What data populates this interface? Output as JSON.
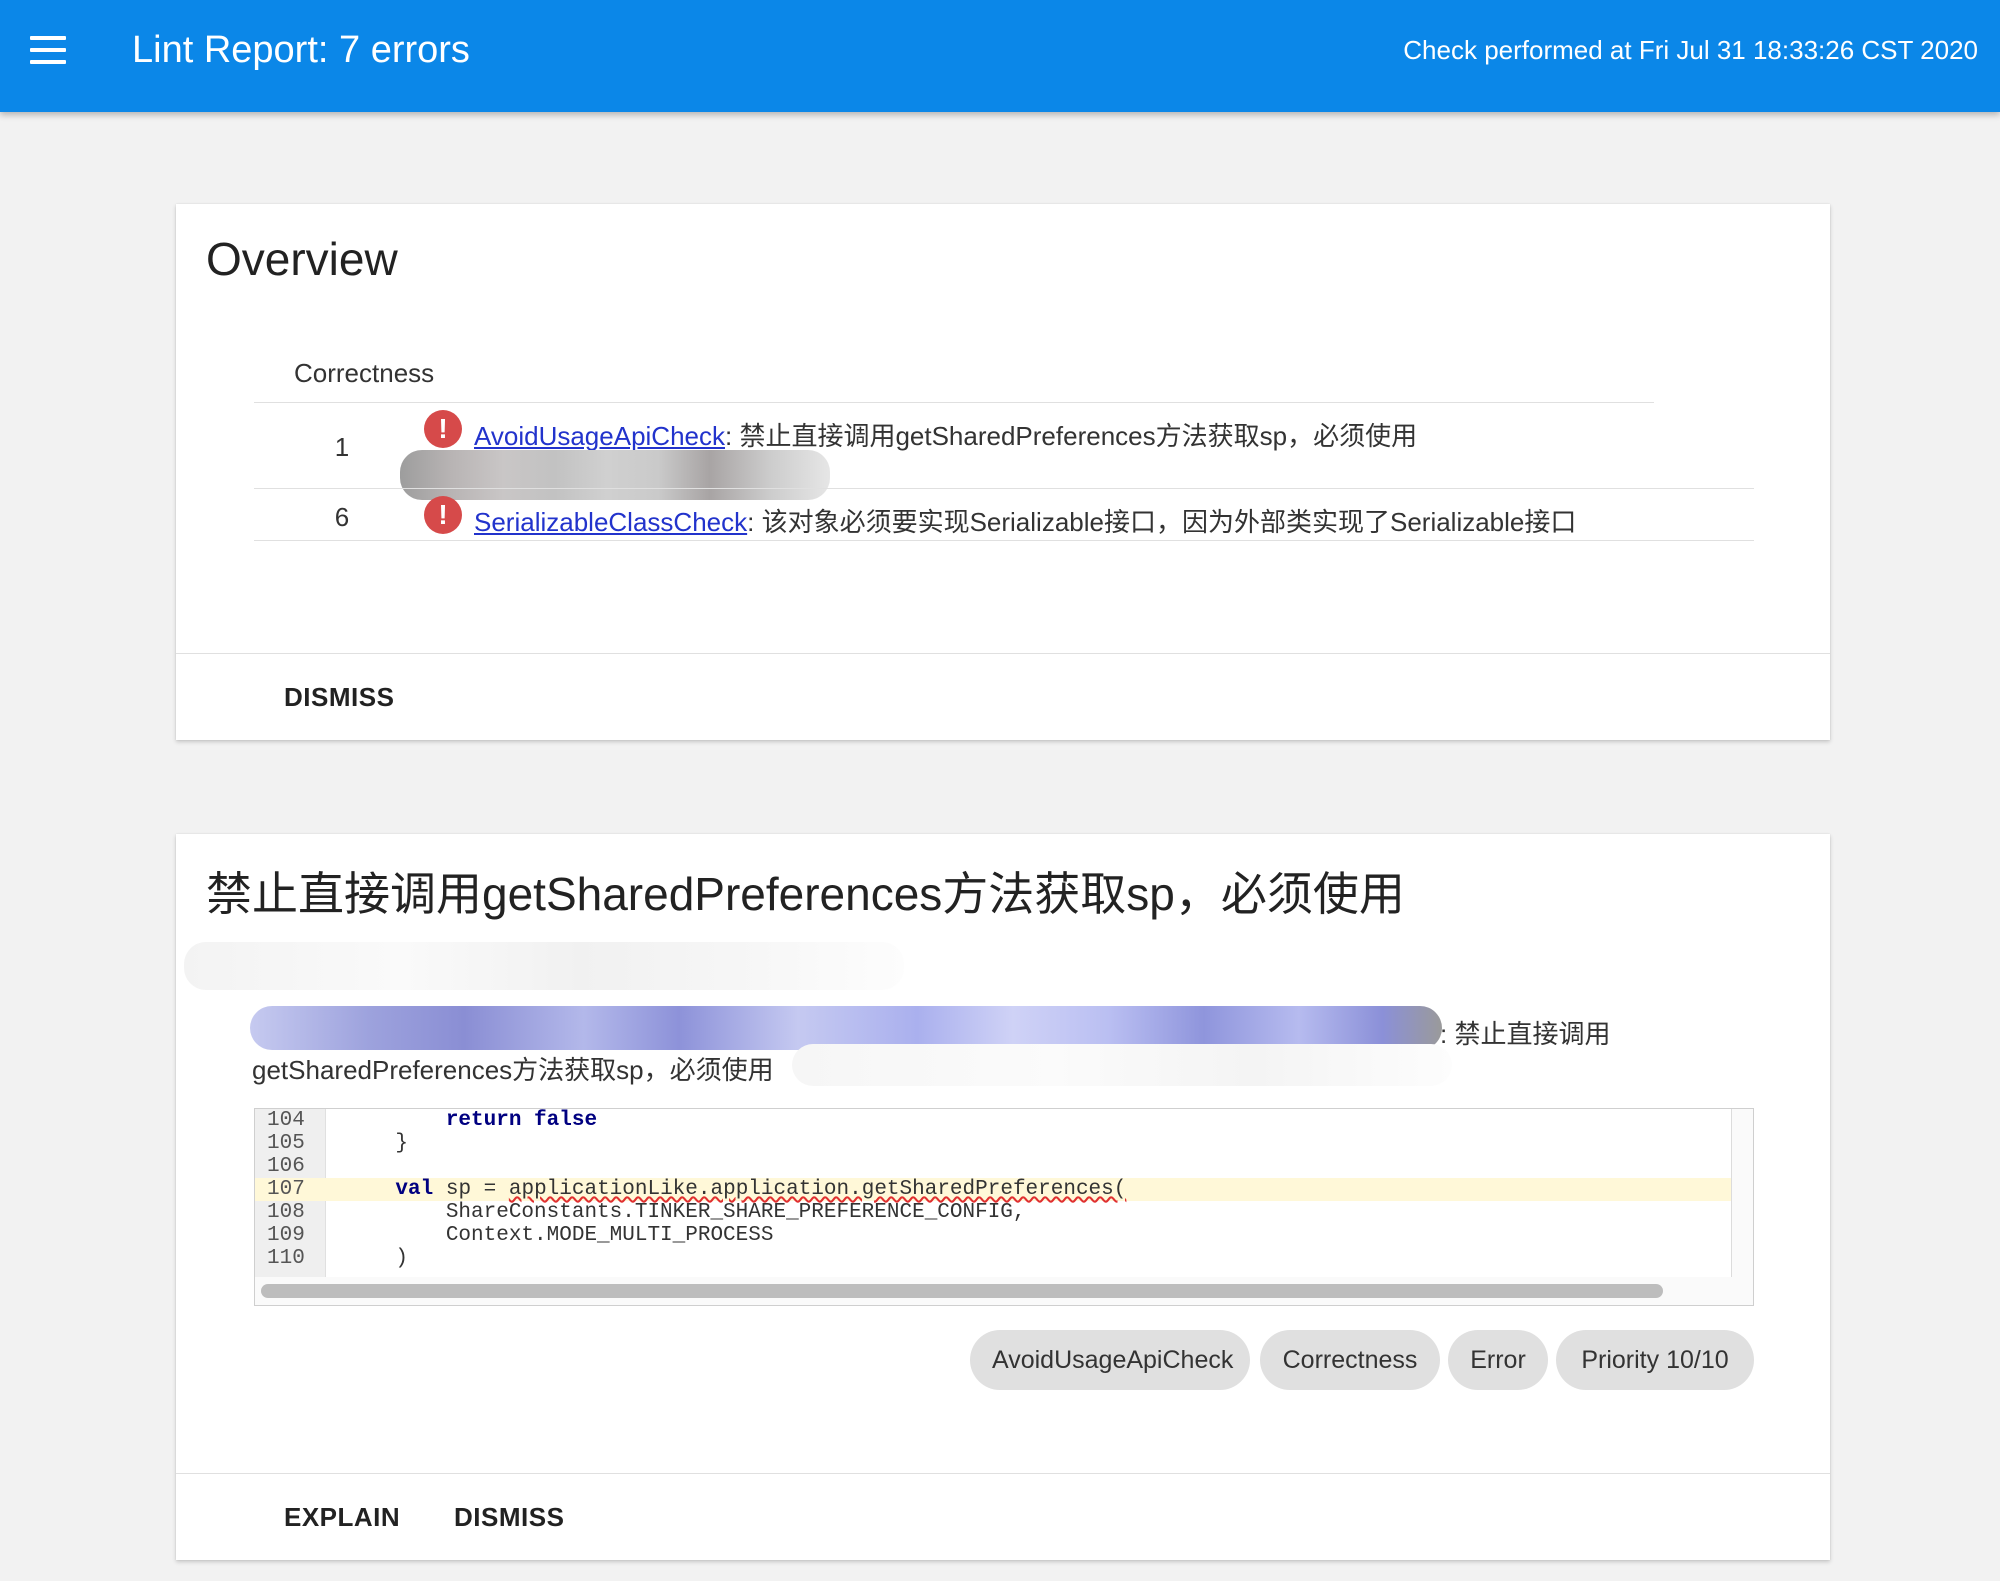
{
  "header": {
    "title": "Lint Report: 7 errors",
    "check_time": "Check performed at Fri Jul 31 18:33:26 CST 2020"
  },
  "overview": {
    "title": "Overview",
    "category": "Correctness",
    "rows": [
      {
        "count": "1",
        "issue_id": "AvoidUsageApiCheck",
        "message": ": 禁止直接调用getSharedPreferences方法获取sp，必须使用"
      },
      {
        "count": "6",
        "issue_id": "SerializableClassCheck",
        "message": ": 该对象必须要实现Serializable接口，因为外部类实现了Serializable接口"
      }
    ],
    "dismiss_label": "DISMISS"
  },
  "issue": {
    "title": "禁止直接调用getSharedPreferences方法获取sp，必须使用",
    "location_suffix": ": 禁止直接调用",
    "description_line2": "getSharedPreferences方法获取sp，必须使用",
    "code": [
      {
        "num": "104",
        "text": "        return false",
        "hl": false
      },
      {
        "num": "105",
        "text": "    }",
        "hl": false
      },
      {
        "num": "106",
        "text": "",
        "hl": false
      },
      {
        "num": "107",
        "text": "    val sp = applicationLike.application.getSharedPreferences(",
        "hl": true
      },
      {
        "num": "108",
        "text": "        ShareConstants.TINKER_SHARE_PREFERENCE_CONFIG,",
        "hl": false
      },
      {
        "num": "109",
        "text": "        Context.MODE_MULTI_PROCESS",
        "hl": false
      },
      {
        "num": "110",
        "text": "    )",
        "hl": false
      }
    ],
    "chips": [
      "AvoidUsageApiCheck",
      "Correctness",
      "Error",
      "Priority 10/10"
    ],
    "explain_label": "EXPLAIN",
    "dismiss_label": "DISMISS"
  },
  "icons": {
    "menu": "hamburger-menu-icon",
    "error": "error-circle-icon"
  },
  "colors": {
    "header_bg": "#0b87e8",
    "error_red": "#d64a4a",
    "link_blue": "#2233cc"
  }
}
